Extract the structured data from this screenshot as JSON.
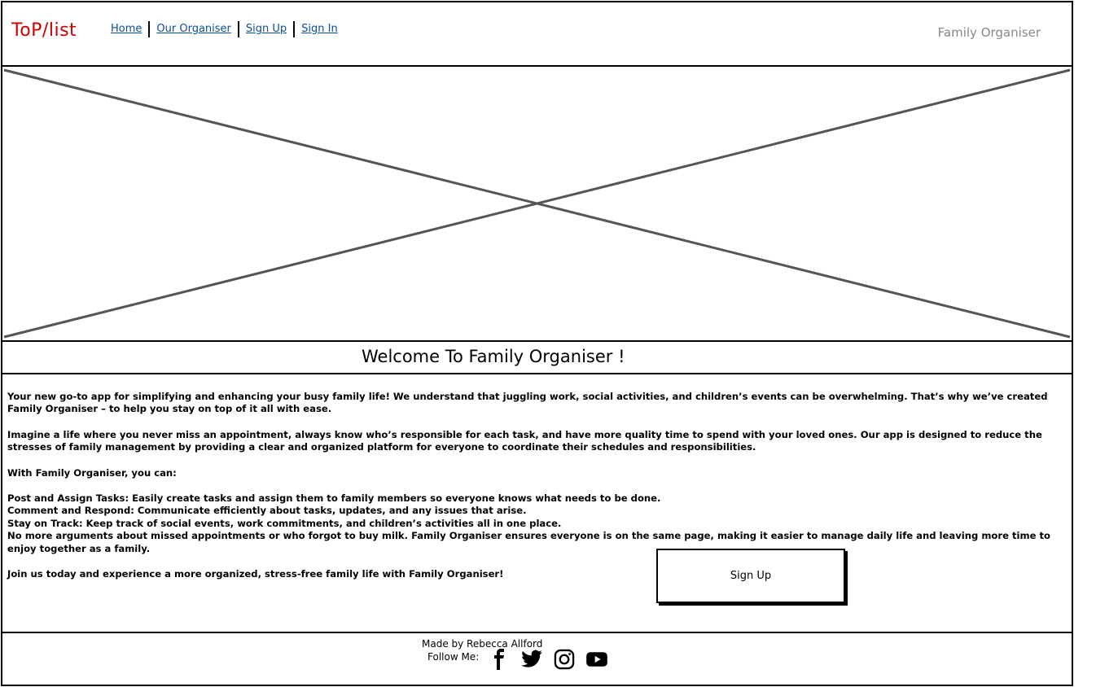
{
  "header": {
    "logo": "ToP/list",
    "nav": [
      "Home",
      "Our Organiser",
      "Sign Up",
      "Sign In"
    ],
    "brand": "Family Organiser"
  },
  "hero": {
    "icon": "image-placeholder-icon"
  },
  "welcome": {
    "title": "Welcome To Family Organiser !"
  },
  "content": {
    "intro": " Your new go-to app for simplifying and enhancing your busy family life! We understand that juggling work, social activities, and children’s events can be overwhelming. That’s why we’ve created Family Organiser – to help you stay on top of it all with ease.",
    "imagine": "Imagine a life where you never miss an appointment, always know who’s responsible for each task, and have more quality time to spend with your loved ones. Our app is designed to reduce the stresses of family management by providing a clear and organized platform for everyone to coordinate their schedules and responsibilities.",
    "with": "With Family Organiser, you can:",
    "post": "Post and Assign Tasks: Easily create tasks and assign them to family members so everyone knows what needs to be done.",
    "comment": "Comment and Respond: Communicate efficiently about tasks, updates, and any issues that arise.",
    "track": "Stay on Track: Keep track of social events, work commitments, and children’s activities all in one place.",
    "nomore": "No more arguments about missed appointments or who forgot to buy milk. Family Organiser ensures everyone is on the same page, making it easier to manage daily life and leaving more time to enjoy together as a family.",
    "join": "Join us today and experience a more organized, stress-free family life with Family Organiser!",
    "signup_label": "Sign Up"
  },
  "footer": {
    "made_by": "Made by Rebecca Allford",
    "follow": "Follow Me:",
    "socials": [
      "facebook-icon",
      "twitter-icon",
      "instagram-icon",
      "youtube-icon"
    ]
  },
  "colors": {
    "logo": "#cc0000",
    "link": "#0b4f9c",
    "brand": "#888888",
    "placeholder_line": "#555555"
  }
}
